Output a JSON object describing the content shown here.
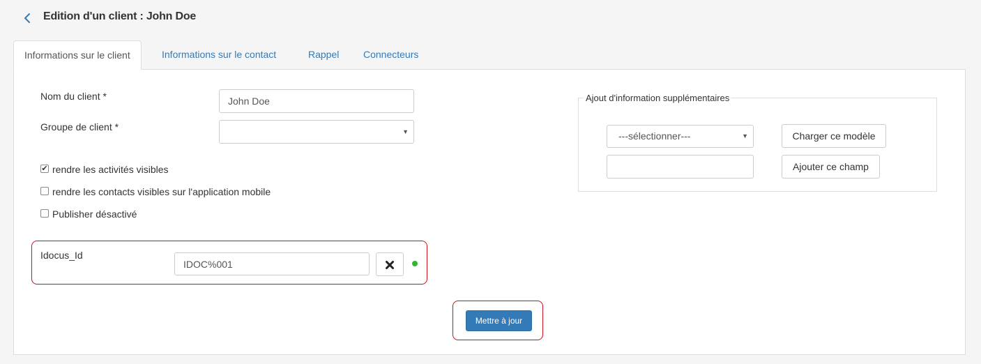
{
  "header": {
    "title": "Edition d'un client : John Doe"
  },
  "tabs": [
    {
      "label": "Informations sur le client",
      "active": true
    },
    {
      "label": "Informations sur le contact",
      "active": false
    },
    {
      "label": "Rappel",
      "active": false
    },
    {
      "label": "Connecteurs",
      "active": false
    }
  ],
  "form": {
    "client_name_label": "Nom du client *",
    "client_name_value": "John Doe",
    "client_group_label": "Groupe de client *",
    "client_group_value": "",
    "checkboxes": [
      {
        "label": "rendre les activités visibles",
        "checked": true
      },
      {
        "label": "rendre les contacts visibles sur l'application mobile",
        "checked": false
      },
      {
        "label": "Publisher désactivé",
        "checked": false
      }
    ],
    "idocus": {
      "label": "Idocus_Id",
      "value": "IDOC%001",
      "clear_icon": "times-icon",
      "status_color": "#2eb82e"
    },
    "submit_label": "Mettre à jour"
  },
  "extra": {
    "legend": "Ajout d'information supplémentaires",
    "select_value": "---sélectionner---",
    "load_button": "Charger ce modèle",
    "field_value": "",
    "add_button": "Ajouter ce champ"
  },
  "colors": {
    "primary": "#337ab7",
    "highlight": "#c9101a",
    "status_ok": "#2eb82e"
  }
}
